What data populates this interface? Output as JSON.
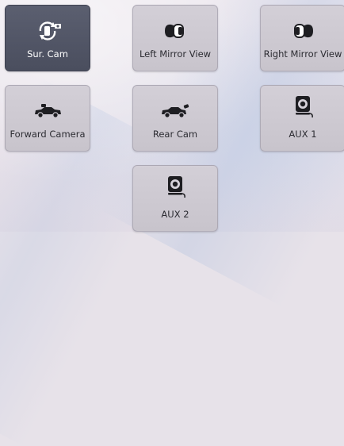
{
  "tiles": [
    {
      "label": "Sur. Cam",
      "icon": "surround-camera-icon",
      "active": true
    },
    {
      "label": "Left Mirror View",
      "icon": "left-mirror-icon",
      "active": false
    },
    {
      "label": "Right Mirror View",
      "icon": "right-mirror-icon",
      "active": false
    },
    {
      "label": "Forward Camera",
      "icon": "forward-camera-icon",
      "active": false
    },
    {
      "label": "Rear Cam",
      "icon": "rear-camera-icon",
      "active": false
    },
    {
      "label": "AUX 1",
      "icon": "aux-camera-icon",
      "active": false
    },
    {
      "label": "AUX 2",
      "icon": "aux-camera-icon",
      "active": false
    }
  ],
  "colors": {
    "active_tile": "#4f5363",
    "inactive_tile": "#cdc9d1",
    "icon_dark": "#1e1e22"
  }
}
